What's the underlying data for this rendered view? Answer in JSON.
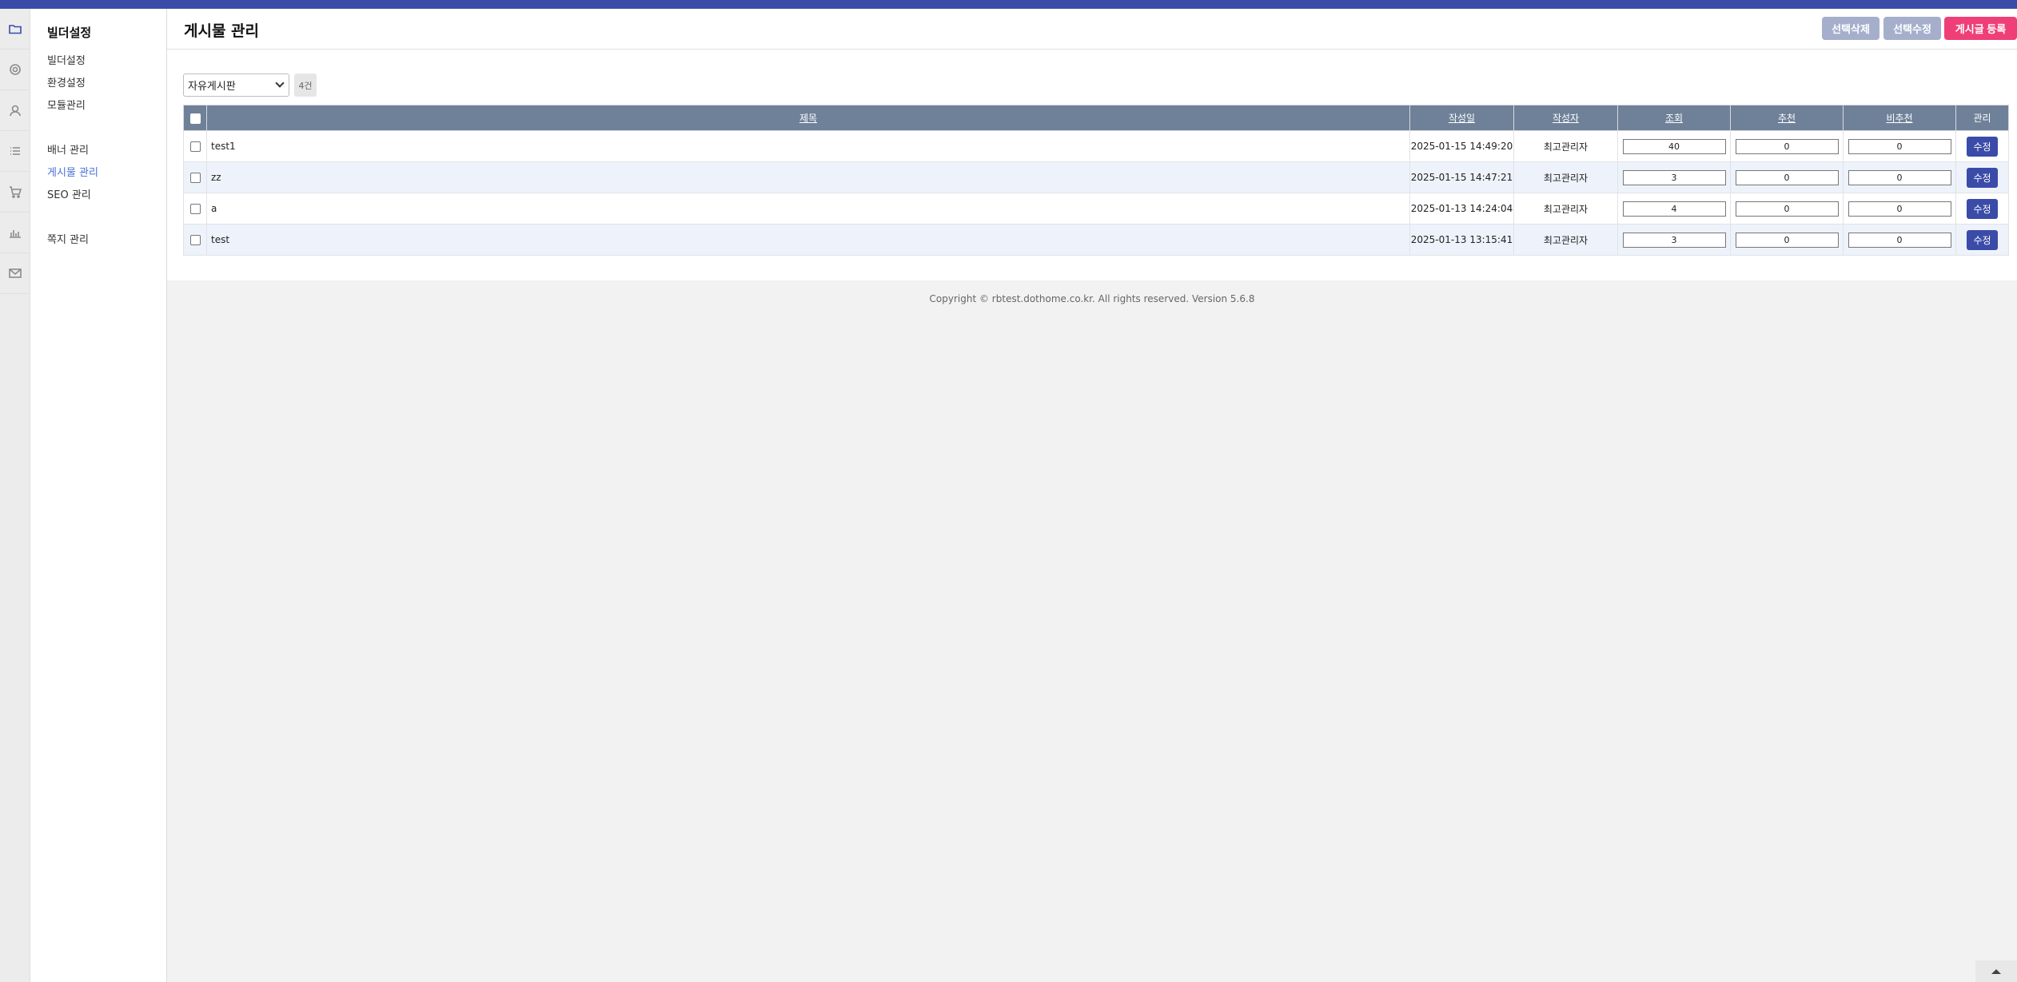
{
  "sidebar": {
    "title": "빌더설정",
    "group1": [
      "빌더설정",
      "환경설정",
      "모듈관리"
    ],
    "group2": [
      "배너 관리",
      "게시물 관리",
      "SEO 관리"
    ],
    "group3": [
      "쪽지 관리"
    ],
    "active_item": "게시물 관리"
  },
  "rail_icons": [
    "folder-icon",
    "gear-icon",
    "user-icon",
    "list-icon",
    "cart-icon",
    "chart-icon",
    "mail-icon"
  ],
  "page": {
    "title": "게시물 관리",
    "buttons": {
      "delete_selected": "선택삭제",
      "edit_selected": "선택수정",
      "new_post": "게시글 등록"
    }
  },
  "filter": {
    "board": "자유게시판",
    "count": "4건"
  },
  "table": {
    "headers": {
      "title": "제목",
      "date": "작성일",
      "author": "작성자",
      "views": "조회",
      "recommend": "추천",
      "not_recommend": "비추천",
      "manage": "관리"
    },
    "edit_label": "수정",
    "rows": [
      {
        "title": "test1",
        "date": "2025-01-15 14:49:20",
        "author": "최고관리자",
        "views": "40",
        "recommend": "0",
        "not_recommend": "0"
      },
      {
        "title": "zz",
        "date": "2025-01-15 14:47:21",
        "author": "최고관리자",
        "views": "3",
        "recommend": "0",
        "not_recommend": "0"
      },
      {
        "title": "a",
        "date": "2025-01-13 14:24:04",
        "author": "최고관리자",
        "views": "4",
        "recommend": "0",
        "not_recommend": "0"
      },
      {
        "title": "test",
        "date": "2025-01-13 13:15:41",
        "author": "최고관리자",
        "views": "3",
        "recommend": "0",
        "not_recommend": "0"
      }
    ]
  },
  "footer": "Copyright © rbtest.dothome.co.kr. All rights reserved. Version 5.6.8",
  "colors": {
    "accent": "#3a4ba8",
    "header_bg": "#6f8199",
    "new_button": "#ef3f78",
    "muted_button": "#a5afcc"
  }
}
